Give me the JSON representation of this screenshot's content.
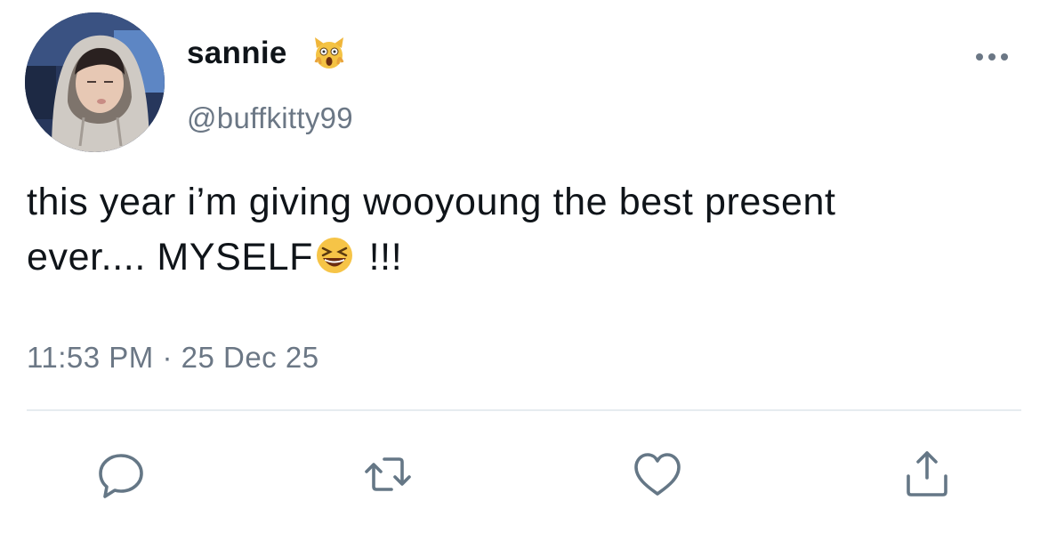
{
  "tweet": {
    "display_name": "sannie",
    "name_emoji": "scream-cat-emoji",
    "handle": "@buffkitty99",
    "text_line1": "this year i’m giving wooyoung the best present",
    "text_line2_before": "ever.... MYSELF",
    "text_emoji": "laughing-face-emoji",
    "text_line2_after": " !!!",
    "timestamp": "11:53 PM · 25 Dec 25"
  },
  "actions": {
    "reply": "reply-icon",
    "retweet": "retweet-icon",
    "like": "heart-icon",
    "share": "share-icon"
  },
  "colors": {
    "text": "#0f1419",
    "secondary": "#6b7785",
    "divider": "#e6ecf0",
    "icon": "#657786"
  }
}
